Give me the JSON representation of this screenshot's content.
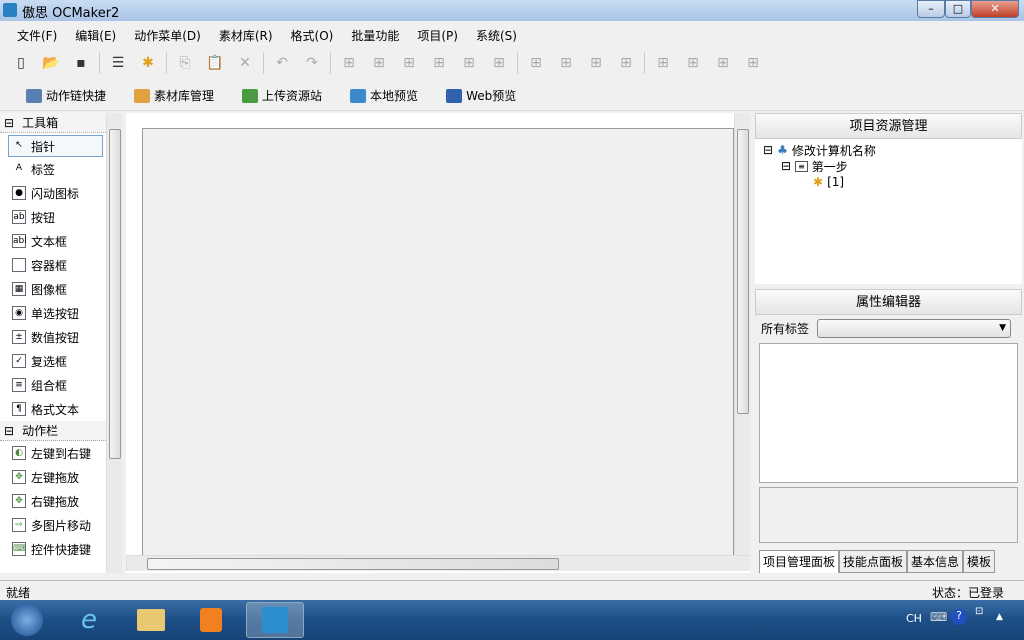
{
  "window": {
    "title": "傲思 OCMaker2",
    "min": "–",
    "max": "□",
    "close": "✕"
  },
  "menu": [
    "文件(F)",
    "编辑(E)",
    "动作菜单(D)",
    "素材库(R)",
    "格式(O)",
    "批量功能",
    "项目(P)",
    "系统(S)"
  ],
  "toolbar": [
    "new-file",
    "open-folder",
    "save",
    "step",
    "puzzle",
    "copy",
    "paste",
    "delete",
    "undo",
    "redo",
    "align-left",
    "align-center",
    "align-right",
    "align-top",
    "align-middle",
    "align-bottom",
    "h-space",
    "h-space-inc",
    "h-space-dec",
    "h-space-remove",
    "v-space",
    "v-space-inc",
    "v-space-dec",
    "v-space-remove"
  ],
  "quickbar": [
    {
      "label": "动作链快捷",
      "color": "#5b7fb0"
    },
    {
      "label": "素材库管理",
      "color": "#e0a040"
    },
    {
      "label": "上传资源站",
      "color": "#4a9a40"
    },
    {
      "label": "本地预览",
      "color": "#3a8ad0"
    },
    {
      "label": "Web预览",
      "color": "#3060b0"
    }
  ],
  "toolbox": {
    "title": "工具箱",
    "items": [
      {
        "label": "指针",
        "icon": "↖"
      },
      {
        "label": "标签",
        "icon": "A"
      },
      {
        "label": "闪动图标",
        "icon": "●"
      },
      {
        "label": "按钮",
        "icon": "ab"
      },
      {
        "label": "文本框",
        "icon": "abl"
      },
      {
        "label": "容器框",
        "icon": ""
      },
      {
        "label": "图像框",
        "icon": "▦"
      },
      {
        "label": "单选按钮",
        "icon": "◉"
      },
      {
        "label": "数值按钮",
        "icon": "±"
      },
      {
        "label": "复选框",
        "icon": "✓"
      },
      {
        "label": "组合框",
        "icon": "≡"
      },
      {
        "label": "格式文本",
        "icon": "¶"
      }
    ],
    "action_title": "动作栏",
    "actions": [
      {
        "label": "左键到右键",
        "icon": "◐"
      },
      {
        "label": "左键拖放",
        "icon": "✥"
      },
      {
        "label": "右键拖放",
        "icon": "✥"
      },
      {
        "label": "多图片移动",
        "icon": "⇨"
      },
      {
        "label": "控件快捷键",
        "icon": "⌨"
      }
    ]
  },
  "project": {
    "title": "项目资源管理",
    "root": "修改计算机名称",
    "step": "第一步",
    "node": "[1]"
  },
  "props": {
    "title": "属性编辑器",
    "label": "所有标签",
    "select": ""
  },
  "tabs": [
    "项目管理面板",
    "技能点面板",
    "基本信息",
    "模板"
  ],
  "status": {
    "left": "就绪",
    "right": "状态：已登录"
  },
  "taskbar": {
    "lang": "CH"
  }
}
